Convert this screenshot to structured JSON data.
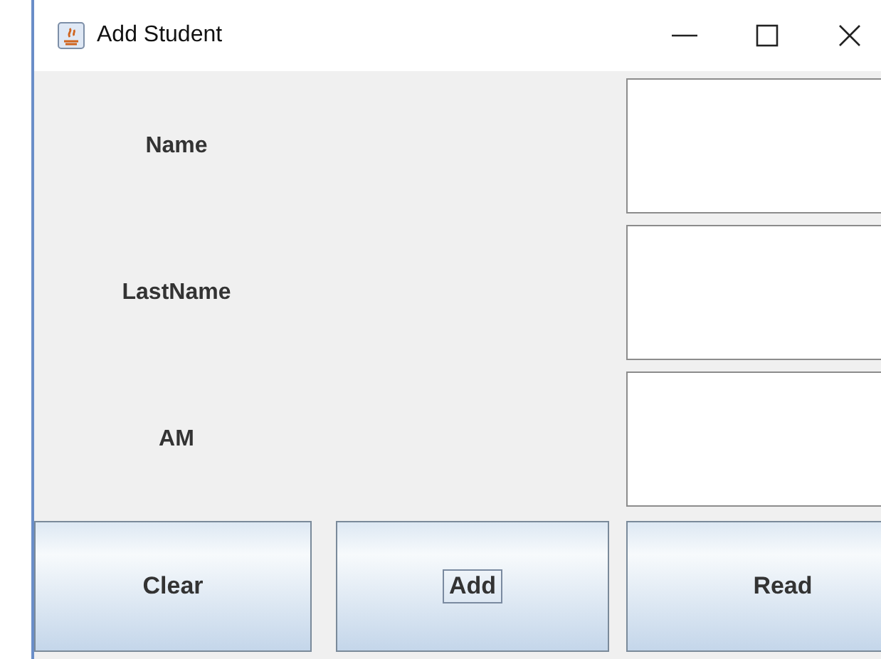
{
  "window": {
    "title": "Add Student"
  },
  "fields": [
    {
      "label": "Name"
    },
    {
      "label": "LastName"
    },
    {
      "label": "AM"
    }
  ],
  "buttons": [
    {
      "label": "Clear",
      "focused": false
    },
    {
      "label": "Add",
      "focused": true
    },
    {
      "label": "Read",
      "focused": false
    }
  ]
}
